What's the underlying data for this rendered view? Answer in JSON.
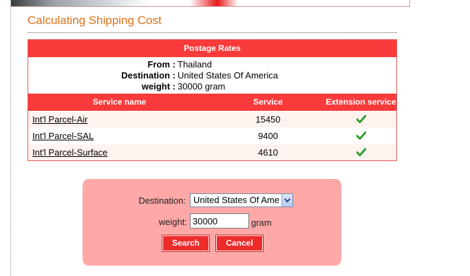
{
  "page": {
    "title": "Calculating Shipping Cost"
  },
  "rates": {
    "header": "Postage Rates",
    "info": [
      {
        "label": "From",
        "value": "Thailand"
      },
      {
        "label": "Destination",
        "value": "United States Of America"
      },
      {
        "label": "weight",
        "value": "30000 gram"
      }
    ],
    "columns": [
      "Service name",
      "Service",
      "Extension service"
    ],
    "rows": [
      {
        "name": "Int'l Parcel-Air",
        "price": "15450",
        "extension": true
      },
      {
        "name": "Int'l Parcel-SAL",
        "price": "9400",
        "extension": true
      },
      {
        "name": "Int'l Parcel-Surface",
        "price": "4610",
        "extension": true
      }
    ]
  },
  "form": {
    "destination_label": "Destination:",
    "destination_value": "United States Of Ame",
    "weight_label": "weight:",
    "weight_value": "30000",
    "weight_unit": "gram",
    "search_label": "Search",
    "cancel_label": "Cancel"
  },
  "colors": {
    "accent": "#f83a3a",
    "title": "#e0701a",
    "form_bg": "#ffa8a8",
    "check": "#2aa02a"
  },
  "icons": {
    "check": "check-icon",
    "dropdown": "chevron-down-icon"
  }
}
